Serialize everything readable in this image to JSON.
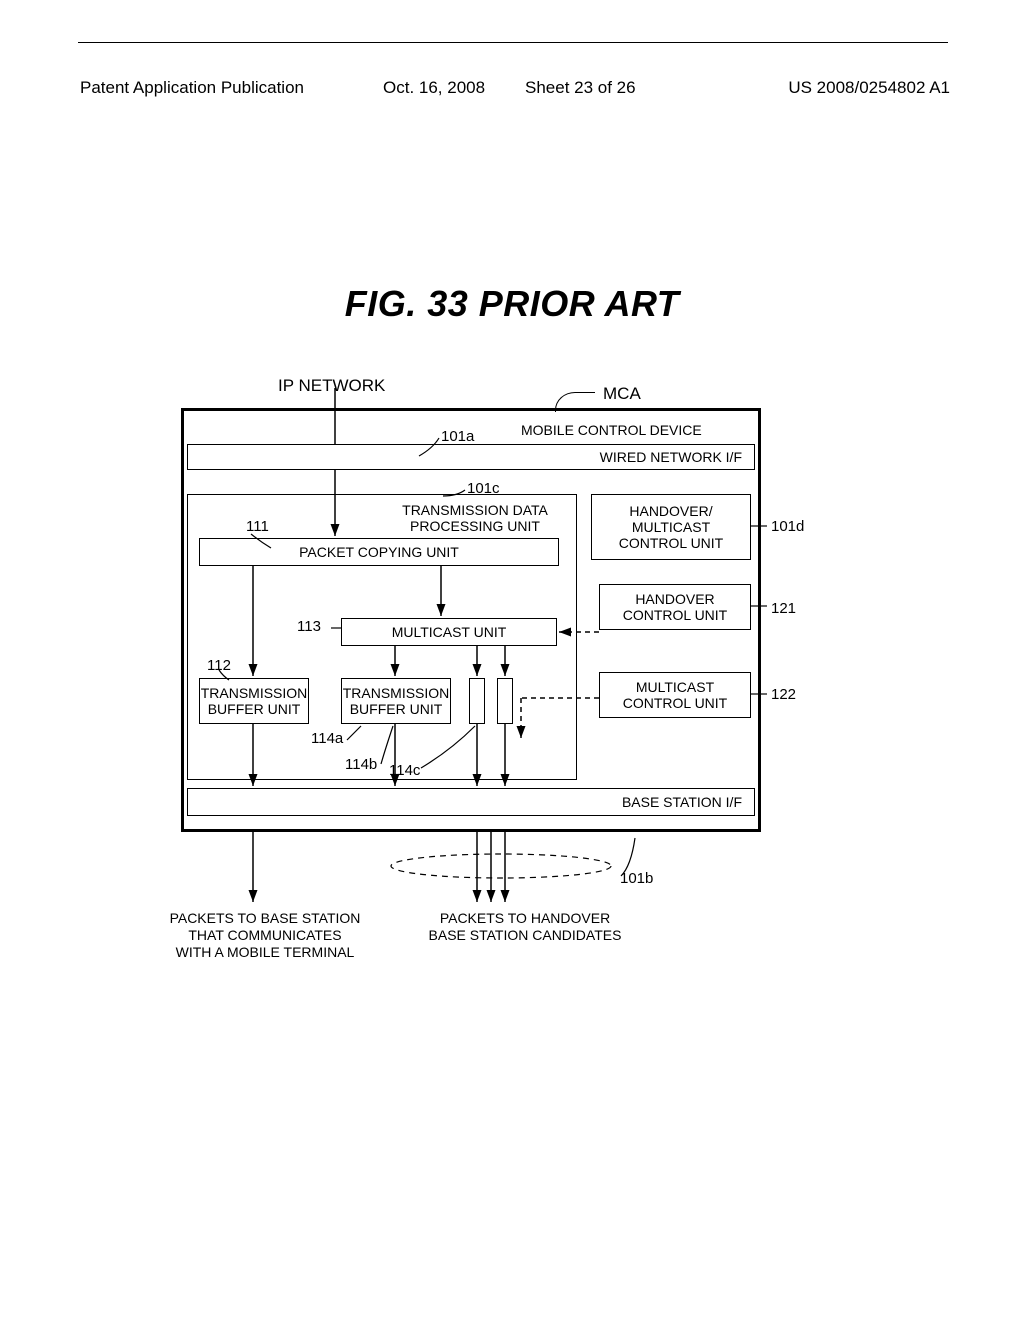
{
  "header": {
    "publication_type": "Patent Application Publication",
    "date": "Oct. 16, 2008",
    "sheet": "Sheet 23 of 26",
    "docket": "US 2008/0254802 A1"
  },
  "figure": {
    "title": "FIG. 33 PRIOR ART",
    "ip_network": "IP NETWORK",
    "mca": "MCA",
    "mobile_control_device": "MOBILE CONTROL DEVICE",
    "wired_if": "WIRED NETWORK I/F",
    "trans_data_unit": "TRANSMISSION DATA\nPROCESSING UNIT",
    "packet_copy": "PACKET COPYING UNIT",
    "multicast_unit": "MULTICAST UNIT",
    "tx_buffer": "TRANSMISSION\nBUFFER UNIT",
    "ho_mc": "HANDOVER/\nMULTICAST\nCONTROL UNIT",
    "ho_ctrl": "HANDOVER\nCONTROL UNIT",
    "mc_ctrl": "MULTICAST\nCONTROL UNIT",
    "base_if": "BASE STATION I/F",
    "out_left": "PACKETS TO BASE STATION\nTHAT COMMUNICATES\nWITH A MOBILE TERMINAL",
    "out_right": "PACKETS TO HANDOVER\nBASE STATION CANDIDATES"
  },
  "refs": {
    "r111": "111",
    "r112": "112",
    "r113": "113",
    "r114a": "114a",
    "r114b": "114b",
    "r114c": "114c",
    "r101a": "101a",
    "r101b": "101b",
    "r101c": "101c",
    "r101d": "101d",
    "r121": "121",
    "r122": "122"
  }
}
